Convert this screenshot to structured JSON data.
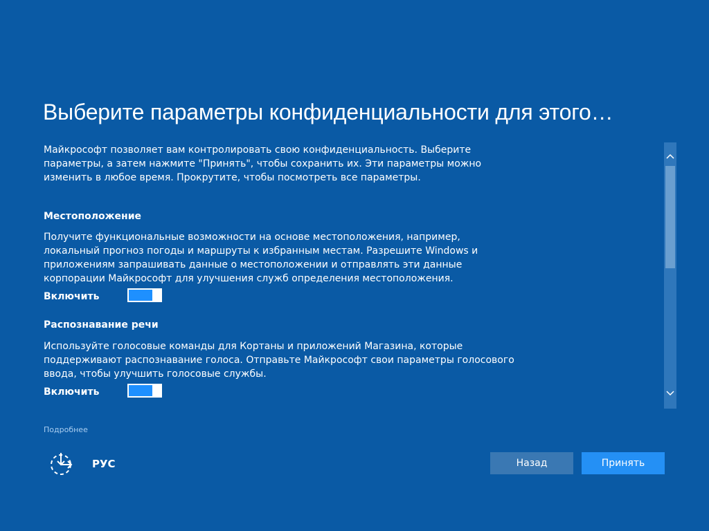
{
  "colors": {
    "background": "#0a5aa5",
    "toggle_on": "#1e90ff",
    "accept_button": "#2490f5",
    "back_button": "#3a78b3",
    "link": "#a9cdf0"
  },
  "header": {
    "title": "Выберите параметры конфиденциальности для этого…"
  },
  "intro": {
    "text": "Майкрософт позволяет вам контролировать свою конфиденциальность. Выберите параметры, а затем нажмите \"Принять\", чтобы сохранить их. Эти параметры можно изменить в любое время. Прокрутите, чтобы посмотреть все параметры."
  },
  "sections": [
    {
      "title": "Местоположение",
      "text": "Получите функциональные возможности на основе местоположения, например, локальный прогноз погоды и маршруты к избранным местам. Разрешите Windows и приложениям запрашивать данные о местоположении и отправлять эти данные корпорации Майкрософт для улучшения служб определения местоположения.",
      "toggle_label": "Включить",
      "toggle_on": true
    },
    {
      "title": "Распознавание речи",
      "text": "Используйте голосовые команды для Кортаны и приложений Магазина, которые поддерживают распознавание голоса. Отправьте Майкрософт свои параметры голосового ввода, чтобы улучшить голосовые службы.",
      "toggle_label": "Включить",
      "toggle_on": true
    }
  ],
  "scrollbar": {
    "up_icon": "chevron-up-icon",
    "down_icon": "chevron-down-icon"
  },
  "footer": {
    "more_link": "Подробнее",
    "ease_of_access_icon": "ease-of-access-icon",
    "language": "РУС",
    "back_label": "Назад",
    "accept_label": "Принять"
  }
}
